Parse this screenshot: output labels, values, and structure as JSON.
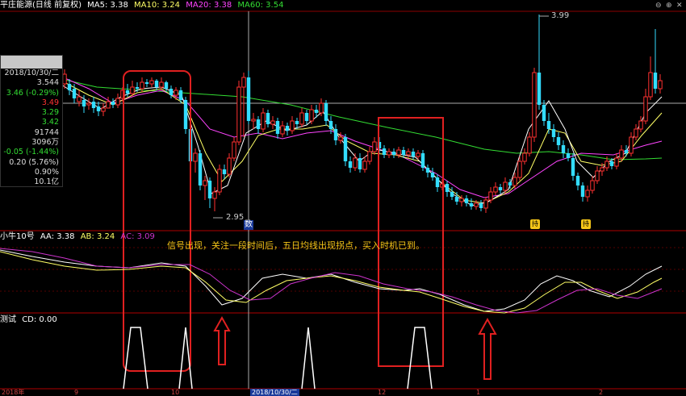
{
  "header": {
    "stock_name": "平庄能源(日线 前复权)",
    "ma5": "MA5: 3.38",
    "ma10": "MA10: 3.24",
    "ma20": "MA20: 3.38",
    "ma60": "MA60: 3.54",
    "colors": {
      "ma5": "#ffffff",
      "ma10": "#ffff66",
      "ma20": "#ff44ff",
      "ma60": "#33dd33"
    }
  },
  "info_panel": {
    "date": "2018/10/30/二",
    "open": "3.544",
    "close_change": "3.46 (-0.29%)",
    "high": "3.49",
    "price4": "3.29",
    "price5": "3.42",
    "volume": "91744",
    "amount": "3096万",
    "change": "-0.05 (-1.44%)",
    "amplitude": "0.20 (5.76%)",
    "turnover": "0.90%",
    "market_cap": "10.1亿"
  },
  "price_chart": {
    "high_label": "3.99",
    "low_label": "2.95",
    "cursor_label": "数",
    "signal_marks": [
      "持",
      "持"
    ]
  },
  "indicator": {
    "name": "小牛10号",
    "aa": "AA: 3.38",
    "ab": "AB: 3.24",
    "ac": "AC: 3.09",
    "annotation": "信号出现，关注一段时间后，五日均线出现拐点，买入时机已到。"
  },
  "test_panel": {
    "name": "测试",
    "cd": "CD: 0.00"
  },
  "axis": {
    "date_labels": [
      "2018年",
      "9",
      "10",
      "12",
      "1",
      "2"
    ],
    "cursor_date": "2018/10/30/二"
  },
  "window_buttons": [
    "⊖",
    "⊕",
    "✕"
  ]
}
